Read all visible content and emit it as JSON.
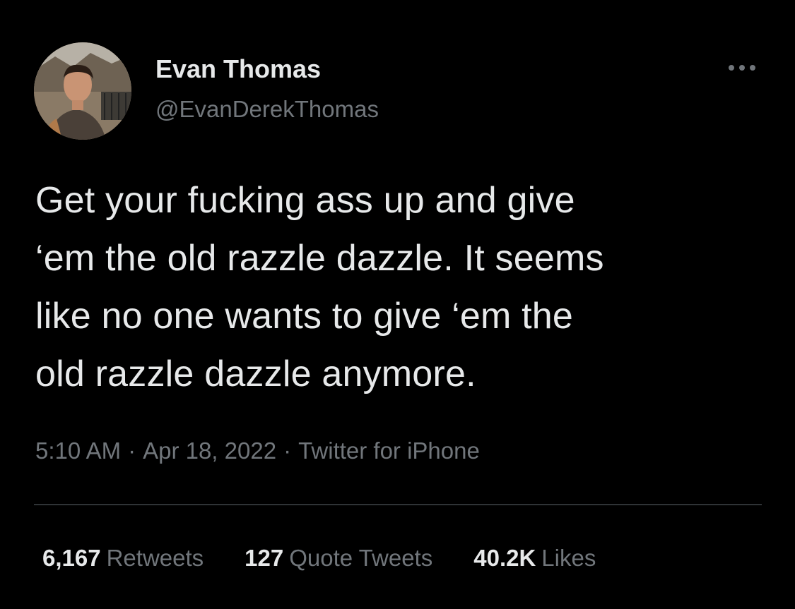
{
  "author": {
    "display_name": "Evan Thomas",
    "handle": "@EvanDerekThomas",
    "avatar_icon": "profile-photo"
  },
  "menu": {
    "more_icon": "ellipsis-icon"
  },
  "tweet": {
    "text_lines": [
      "Get your fucking ass up and give",
      "‘em the old razzle dazzle. It seems",
      "like no one wants to give ‘em the",
      "old razzle dazzle anymore."
    ]
  },
  "meta": {
    "time": "5:10 AM",
    "separator": "·",
    "date": "Apr 18, 2022",
    "source": "Twitter for iPhone"
  },
  "stats": {
    "retweets": {
      "count": "6,167",
      "label": "Retweets"
    },
    "quote_tweets": {
      "count": "127",
      "label": "Quote Tweets"
    },
    "likes": {
      "count": "40.2K",
      "label": "Likes"
    }
  },
  "colors": {
    "background": "#000000",
    "primary_text": "#e7e9ea",
    "secondary_text": "#71767b",
    "divider": "#2f3336"
  }
}
